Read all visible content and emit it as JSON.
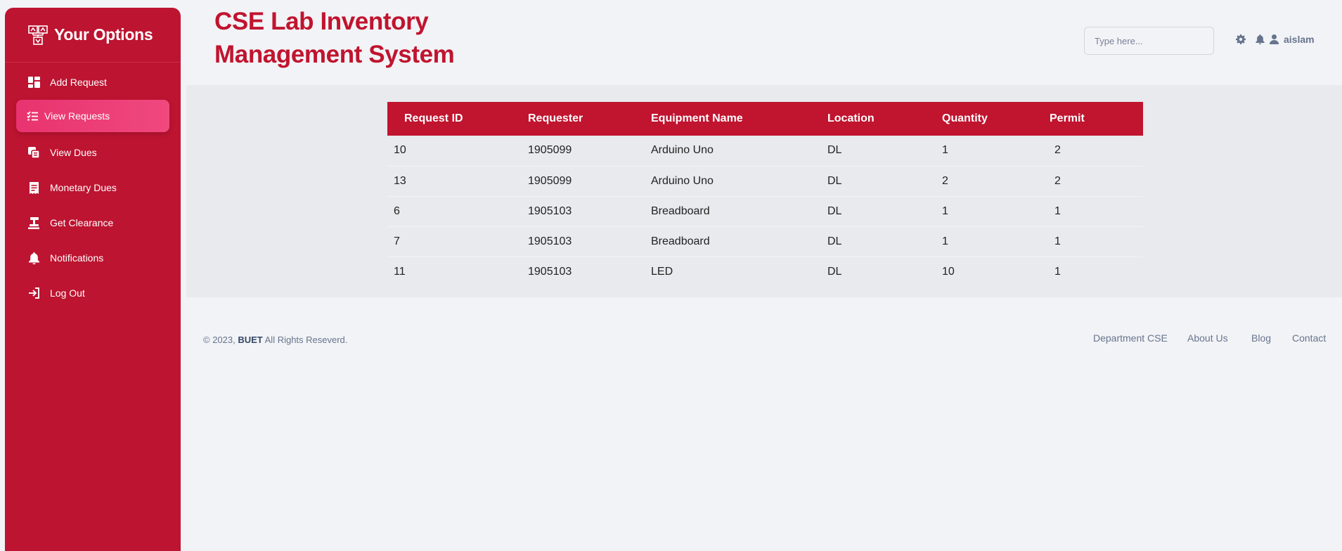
{
  "sidebar": {
    "title": "Your Options",
    "items": [
      {
        "label": "Add Request",
        "icon": "dashboard-icon",
        "active": false
      },
      {
        "label": "View Requests",
        "icon": "list-check-icon",
        "active": true
      },
      {
        "label": "View Dues",
        "icon": "copy-icon",
        "active": false
      },
      {
        "label": "Monetary Dues",
        "icon": "receipt-icon",
        "active": false
      },
      {
        "label": "Get Clearance",
        "icon": "stamp-icon",
        "active": false
      },
      {
        "label": "Notifications",
        "icon": "bell-icon",
        "active": false
      },
      {
        "label": "Log Out",
        "icon": "sign-in-icon",
        "active": false
      }
    ]
  },
  "header": {
    "title": "CSE Lab Inventory Management System",
    "search_placeholder": "Type here...",
    "username": "aislam"
  },
  "table": {
    "columns": [
      "Request ID",
      "Requester",
      "Equipment Name",
      "Location",
      "Quantity",
      "Permit"
    ],
    "rows": [
      [
        "10",
        "1905099",
        "Arduino Uno",
        "DL",
        "1",
        "2"
      ],
      [
        "13",
        "1905099",
        "Arduino Uno",
        "DL",
        "2",
        "2"
      ],
      [
        "6",
        "1905103",
        "Breadboard",
        "DL",
        "1",
        "1"
      ],
      [
        "7",
        "1905103",
        "Breadboard",
        "DL",
        "1",
        "1"
      ],
      [
        "11",
        "1905103",
        "LED",
        "DL",
        "10",
        "1"
      ]
    ]
  },
  "footer": {
    "copyright_prefix": "© 2023, ",
    "copyright_org": "BUET",
    "copyright_suffix": " All Rights Reseverd.",
    "links": [
      "Department CSE",
      "About Us",
      "Blog",
      "Contact"
    ]
  },
  "colors": {
    "primary": "#c0142f",
    "active_nav": "#e8336f",
    "background": "#f2f3f6"
  }
}
